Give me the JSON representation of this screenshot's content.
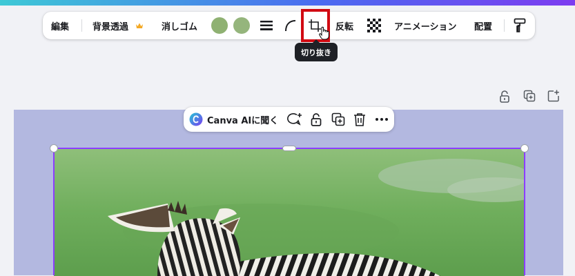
{
  "toolbar": {
    "edit_label": "編集",
    "bg_remove_label": "背景透過",
    "premium_icon": "crown-icon",
    "eraser_label": "消しゴム",
    "swatch_colors": [
      "#8fb172",
      "#95b57c"
    ],
    "border_style_icon": "lines-icon",
    "corner_rounding_icon": "corner-icon",
    "crop_icon": "crop-icon",
    "flip_label": "反転",
    "transparency_icon": "checkerboard-icon",
    "animation_label": "アニメーション",
    "position_label": "配置",
    "copy_style_icon": "paint-roller-icon"
  },
  "tooltip": {
    "text": "切り抜き"
  },
  "page_actions": [
    "lock-icon",
    "duplicate-page-icon",
    "add-page-icon"
  ],
  "context_menu": {
    "ai_label": "Canva AIに聞く",
    "icons": [
      "comment-add-icon",
      "lock-icon",
      "duplicate-icon",
      "trash-icon",
      "more-icon"
    ]
  },
  "colors": {
    "accent_purple": "#8b3dff",
    "canvas_bg": "#b3b8e0",
    "highlight_red": "#d10a12"
  }
}
